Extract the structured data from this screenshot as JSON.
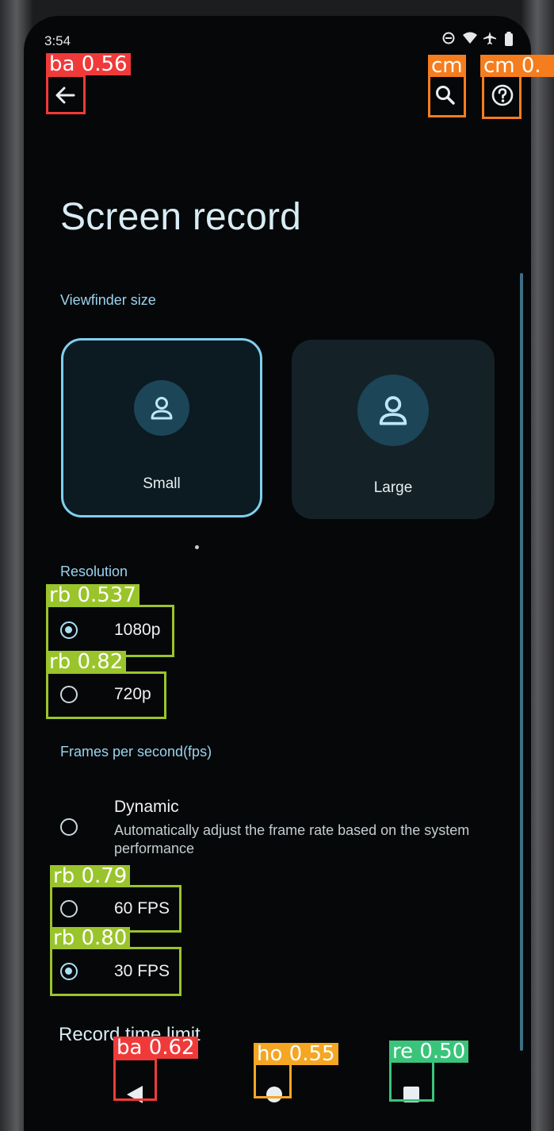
{
  "status_bar": {
    "time": "3:54"
  },
  "page": {
    "title": "Screen record"
  },
  "viewfinder": {
    "label": "Viewfinder size",
    "options": [
      {
        "label": "Small",
        "selected": true
      },
      {
        "label": "Large",
        "selected": false
      }
    ]
  },
  "resolution": {
    "label": "Resolution",
    "options": [
      {
        "label": "1080p",
        "selected": true
      },
      {
        "label": "720p",
        "selected": false
      }
    ]
  },
  "fps": {
    "label": "Frames per second(fps)",
    "options": [
      {
        "label": "Dynamic",
        "description": "Automatically adjust the frame rate based on the system performance",
        "selected": false
      },
      {
        "label": "60 FPS",
        "selected": false
      },
      {
        "label": "30 FPS",
        "selected": true
      }
    ]
  },
  "record_limit": {
    "label": "Record time limit"
  },
  "detections": [
    {
      "tag": "ba 0.56",
      "color": "#f03a3a"
    },
    {
      "tag": "cm",
      "color": "#f57d1e"
    },
    {
      "tag": "cm 0.",
      "color": "#f57d1e"
    },
    {
      "tag": "rb 0.537",
      "color": "#9ac42b"
    },
    {
      "tag": "rb 0.82",
      "color": "#9ac42b"
    },
    {
      "tag": "rb 0.79",
      "color": "#9ac42b"
    },
    {
      "tag": "rb 0.80",
      "color": "#9ac42b"
    },
    {
      "tag": "ba 0.62",
      "color": "#f03a3a"
    },
    {
      "tag": "ho 0.55",
      "color": "#f5a623"
    },
    {
      "tag": "re 0.50",
      "color": "#3ac47a"
    }
  ],
  "colors": {
    "accent": "#7fd0ef",
    "background": "#060708"
  }
}
